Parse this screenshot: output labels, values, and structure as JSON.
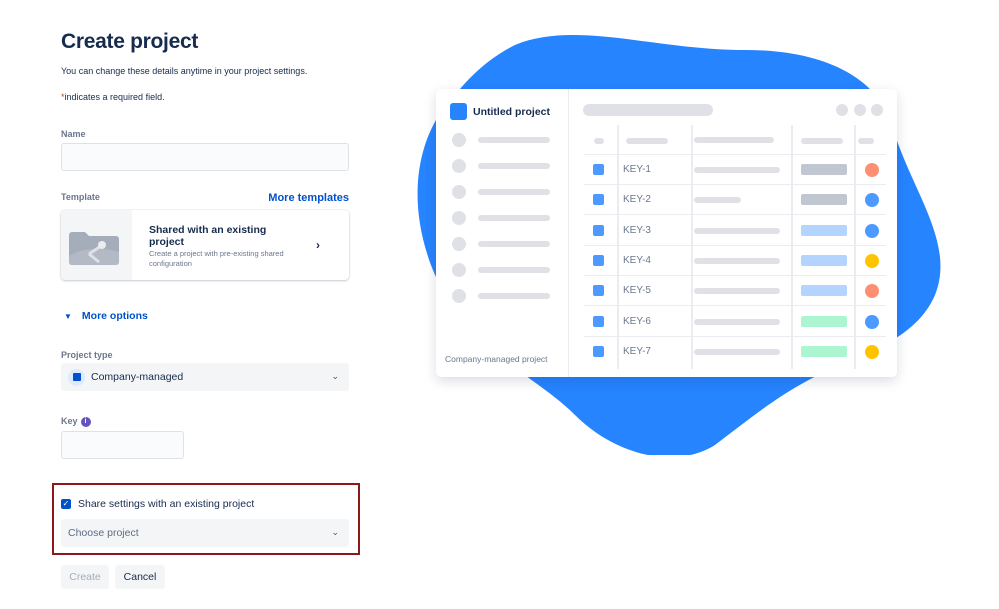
{
  "form": {
    "title": "Create project",
    "subtitle": "You can change these details anytime in your project settings.",
    "required_star": "*",
    "required_note": "indicates a required field.",
    "name": {
      "label": "Name",
      "value": "",
      "placeholder": ""
    },
    "template": {
      "label": "Template",
      "more_link": "More templates",
      "card_title": "Shared with an existing project",
      "card_description": "Create a project with pre-existing shared configuration",
      "chevron": "›"
    },
    "more_options": {
      "label": "More options",
      "icon": "chevron-down"
    },
    "project_type": {
      "label": "Project type",
      "value": "Company-managed"
    },
    "key": {
      "label": "Key",
      "info_icon": "i",
      "value": ""
    },
    "share_settings": {
      "label": "Share settings with an existing project",
      "checked": true
    },
    "choose_project": {
      "placeholder": "Choose project"
    },
    "buttons": {
      "create": "Create",
      "cancel": "Cancel"
    }
  },
  "illustration": {
    "project_title": "Untitled project",
    "footer": "Company-managed project",
    "rows": [
      {
        "key": "KEY-1",
        "status_color": "#c1c7d0",
        "priority_color": "#ff8f73",
        "summary_short": false
      },
      {
        "key": "KEY-2",
        "status_color": "#c1c7d0",
        "priority_color": "#4c9aff",
        "summary_short": true
      },
      {
        "key": "KEY-3",
        "status_color": "#b3d4ff",
        "priority_color": "#4c9aff",
        "summary_short": false
      },
      {
        "key": "KEY-4",
        "status_color": "#b3d4ff",
        "priority_color": "#ffc400",
        "summary_short": false
      },
      {
        "key": "KEY-5",
        "status_color": "#b3d4ff",
        "priority_color": "#ff8f73",
        "summary_short": false
      },
      {
        "key": "KEY-6",
        "status_color": "#abf5d1",
        "priority_color": "#4c9aff",
        "summary_short": false
      },
      {
        "key": "KEY-7",
        "status_color": "#abf5d1",
        "priority_color": "#ffc400",
        "summary_short": false
      }
    ]
  },
  "colors": {
    "brand": "#0052cc",
    "blob": "#2684ff",
    "highlight": "#8b1a1a"
  }
}
